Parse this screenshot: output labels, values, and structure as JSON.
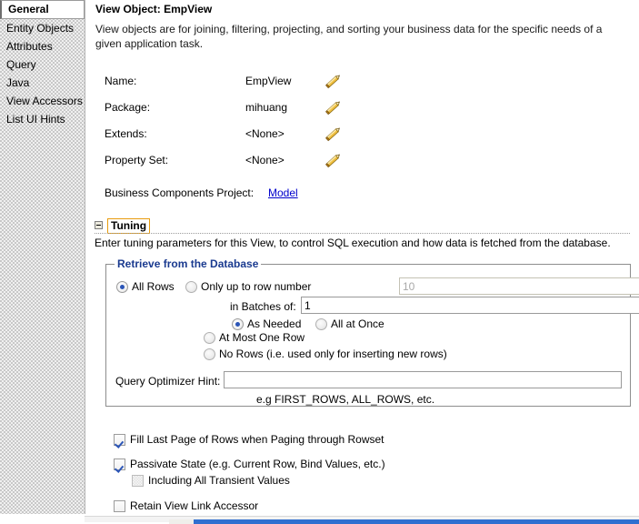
{
  "sidebar": {
    "items": [
      {
        "label": "General",
        "selected": true
      },
      {
        "label": "Entity Objects",
        "selected": false
      },
      {
        "label": "Attributes",
        "selected": false
      },
      {
        "label": "Query",
        "selected": false
      },
      {
        "label": "Java",
        "selected": false
      },
      {
        "label": "View Accessors",
        "selected": false
      },
      {
        "label": "List UI Hints",
        "selected": false
      }
    ]
  },
  "header": {
    "title": "View Object: EmpView",
    "description": "View objects are for joining, filtering, projecting, and sorting your business data for the specific needs of a given application task."
  },
  "properties": [
    {
      "label": "Name:",
      "value": "EmpView",
      "edit_icon": "pencil-icon"
    },
    {
      "label": "Package:",
      "value": "mihuang",
      "edit_icon": "pencil-icon"
    },
    {
      "label": "Extends:",
      "value": "<None>",
      "edit_icon": "pencil-icon"
    },
    {
      "label": "Property Set:",
      "value": "<None>",
      "edit_icon": "pencil-icon"
    }
  ],
  "business_components_project": {
    "label": "Business Components Project:",
    "link_text": "Model"
  },
  "tuning": {
    "section_label": "Tuning",
    "expanded": true,
    "description": "Enter tuning parameters for this View, to control SQL execution and how data is fetched from the database.",
    "group": {
      "title": "Retrieve from the Database",
      "radios": {
        "all_rows": {
          "label": "All Rows",
          "checked": true
        },
        "only_up_to": {
          "label": "Only up to row number",
          "checked": false
        },
        "as_needed": {
          "label": "As Needed",
          "checked": true
        },
        "all_at_once": {
          "label": "All at Once",
          "checked": false
        },
        "at_most_one_row": {
          "label": "At Most One Row",
          "checked": false
        },
        "no_rows": {
          "label": "No Rows (i.e. used only for inserting new rows)",
          "checked": false
        }
      },
      "fields": {
        "row_number": {
          "value": "10",
          "disabled": true
        },
        "in_batches_of": {
          "label": "in Batches of:",
          "value": "1",
          "disabled": false
        },
        "query_optimizer_hint": {
          "label": "Query Optimizer Hint:",
          "value": "",
          "disabled": false
        },
        "query_optimizer_hint_example": "e.g FIRST_ROWS, ALL_ROWS, etc."
      }
    },
    "checkboxes": [
      {
        "label": "Fill Last Page of Rows when Paging through Rowset",
        "checked": true,
        "disabled": false
      },
      {
        "label": "Passivate State (e.g. Current Row, Bind Values, etc.)",
        "checked": true,
        "disabled": false
      },
      {
        "label": "Including All Transient Values",
        "checked": false,
        "disabled": true
      },
      {
        "label": "Retain View Link Accessor",
        "checked": false,
        "disabled": false
      }
    ]
  },
  "colors": {
    "link": "#0000cc",
    "group_title": "#1a3a8f",
    "focus_outline": "#e89c0e",
    "control_accent": "#2b55b7",
    "scrollbar_thumb": "#2f6fd0"
  }
}
